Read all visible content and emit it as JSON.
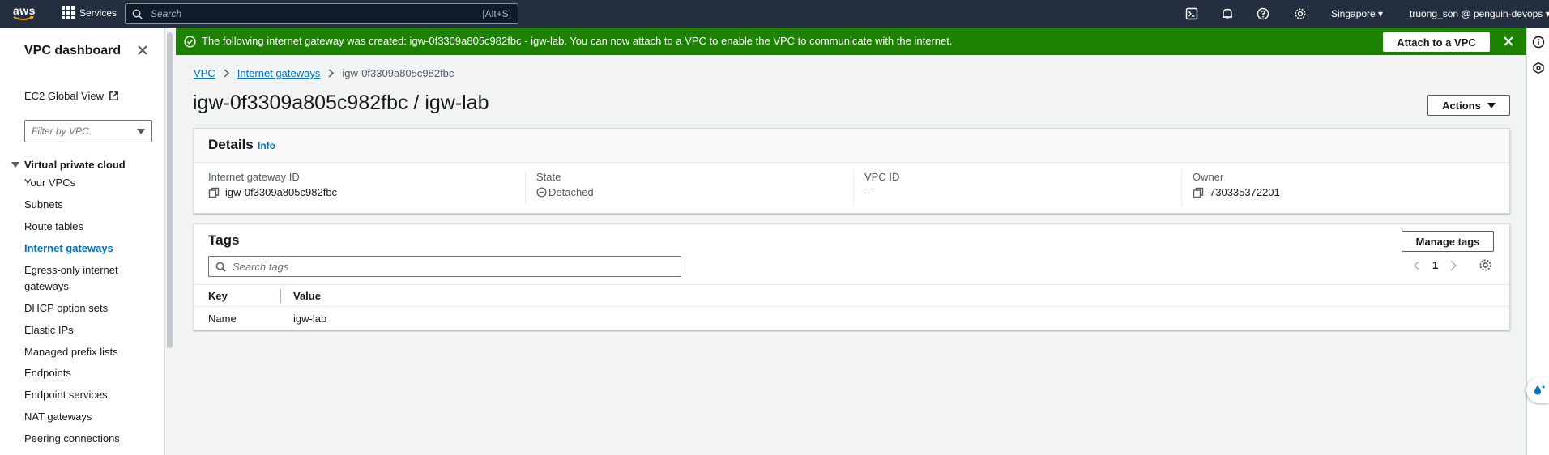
{
  "topnav": {
    "logo_text": "aws",
    "services_label": "Services",
    "search_placeholder": "Search",
    "search_shortcut": "[Alt+S]",
    "region": "Singapore",
    "account": "truong_son @ penguin-devops"
  },
  "sidebar": {
    "title": "VPC dashboard",
    "ec2_global_view": "EC2 Global View",
    "filter_placeholder": "Filter by VPC",
    "section": "Virtual private cloud",
    "items": [
      {
        "label": "Your VPCs",
        "active": false
      },
      {
        "label": "Subnets",
        "active": false
      },
      {
        "label": "Route tables",
        "active": false
      },
      {
        "label": "Internet gateways",
        "active": true
      },
      {
        "label": "Egress-only internet gateways",
        "active": false
      },
      {
        "label": "DHCP option sets",
        "active": false
      },
      {
        "label": "Elastic IPs",
        "active": false
      },
      {
        "label": "Managed prefix lists",
        "active": false
      },
      {
        "label": "Endpoints",
        "active": false
      },
      {
        "label": "Endpoint services",
        "active": false
      },
      {
        "label": "NAT gateways",
        "active": false
      },
      {
        "label": "Peering connections",
        "active": false
      }
    ]
  },
  "banner": {
    "message": "The following internet gateway was created: igw-0f3309a805c982fbc - igw-lab. You can now attach to a VPC to enable the VPC to communicate with the internet.",
    "action_label": "Attach to a VPC",
    "color": "#1d8102"
  },
  "breadcrumb": {
    "items": [
      "VPC",
      "Internet gateways"
    ],
    "current": "igw-0f3309a805c982fbc"
  },
  "page": {
    "title": "igw-0f3309a805c982fbc / igw-lab",
    "actions_label": "Actions"
  },
  "details": {
    "title": "Details",
    "info_link": "Info",
    "fields": [
      {
        "label": "Internet gateway ID",
        "value": "igw-0f3309a805c982fbc",
        "icon": "copy-icon"
      },
      {
        "label": "State",
        "value": "Detached",
        "icon": "detached-status-icon"
      },
      {
        "label": "VPC ID",
        "value": "–",
        "icon": ""
      },
      {
        "label": "Owner",
        "value": "730335372201",
        "icon": "copy-icon"
      }
    ]
  },
  "tags": {
    "title": "Tags",
    "manage_label": "Manage tags",
    "search_placeholder": "Search tags",
    "page_number": "1",
    "columns": [
      "Key",
      "Value"
    ],
    "rows": [
      {
        "key": "Name",
        "value": "igw-lab"
      }
    ]
  }
}
